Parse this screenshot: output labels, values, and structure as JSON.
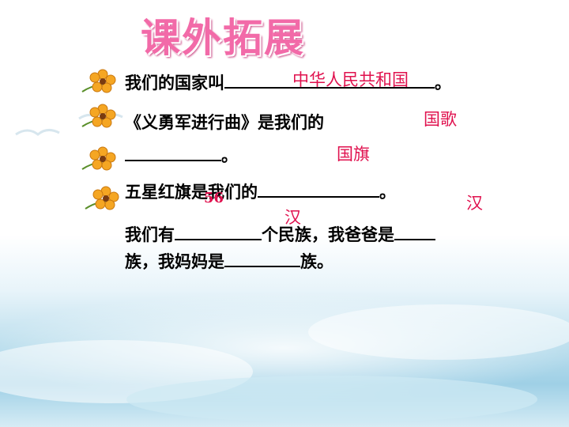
{
  "title": "课外拓展",
  "lines": {
    "l1_prefix": "我们的国家叫",
    "l1_suffix": "。",
    "l2_text": "《义勇军进行曲》是我们的",
    "l3_suffix": "。",
    "l4_prefix": "五星红旗是我们的",
    "l4_suffix": "。",
    "l5_prefix": "我们有",
    "l5_mid": "个民族，我爸爸是",
    "l6_prefix": "族，我妈妈是",
    "l6_suffix": "族。"
  },
  "answers": {
    "country": "中华人民共和国",
    "anthem": "国歌",
    "flag": "国旗",
    "ethnic_count": "56",
    "father": "汉",
    "mother": "汉"
  },
  "icons": [
    "flower-icon",
    "flower-icon",
    "flower-icon",
    "flower-icon"
  ],
  "colors": {
    "title": "#f26aa8",
    "answer": "#e0114e"
  }
}
